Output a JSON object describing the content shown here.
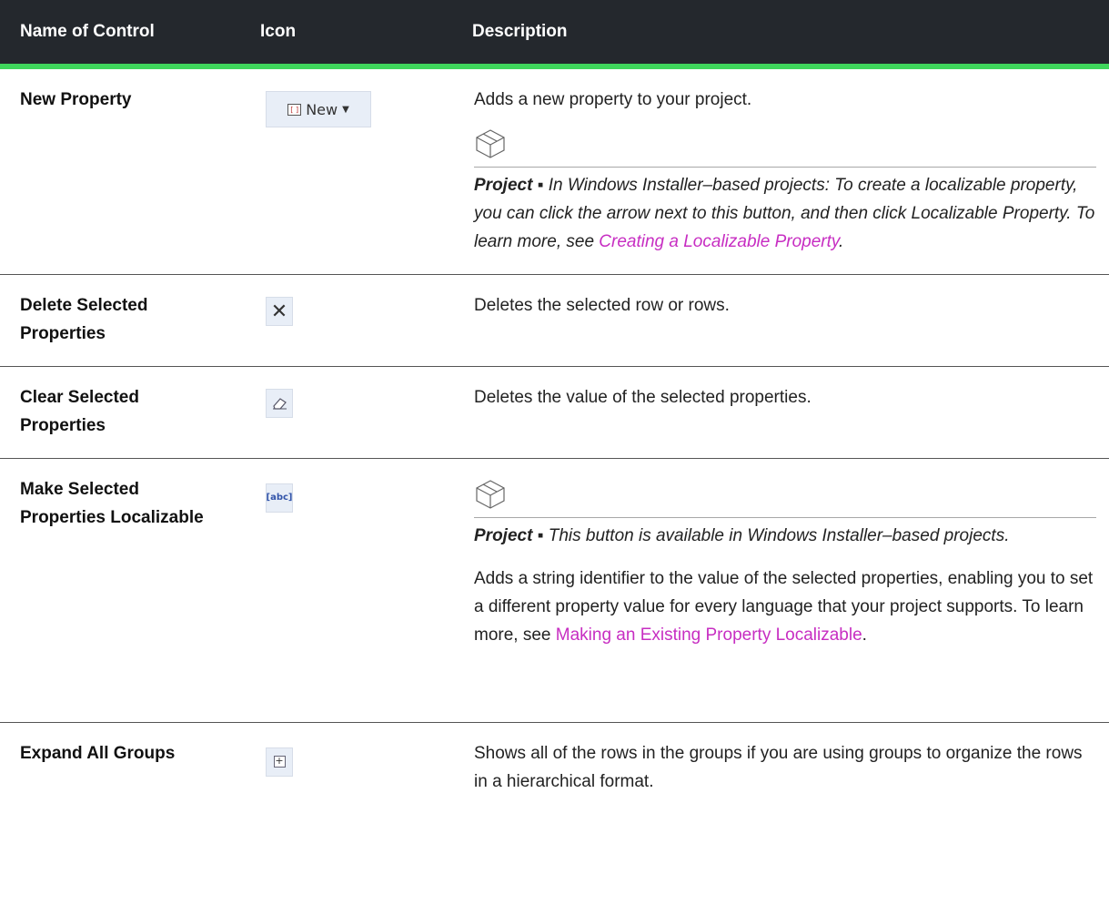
{
  "header": {
    "col_name": "Name of Control",
    "col_icon": "Icon",
    "col_desc": "Description"
  },
  "rows": [
    {
      "name": "New Property",
      "icon_name": "new-dropdown-icon",
      "icon_label": "New",
      "desc_text": "Adds a new property to your project.",
      "note_label": "Project ▪",
      "note_text": " In Windows Installer–based projects: To create a localizable property, you can click the arrow next to this button, and then click Localizable Property. To learn more, see ",
      "note_link": "Creating a Localizable Property",
      "note_end": "."
    },
    {
      "name": "Delete Selected Properties",
      "icon_name": "delete-x-icon",
      "desc_text": "Deletes the selected row or rows."
    },
    {
      "name": "Clear Selected Properties",
      "icon_name": "eraser-icon",
      "desc_text": "Deletes the value of the selected properties."
    },
    {
      "name": "Make Selected Properties Localizable",
      "icon_name": "abc-localize-icon",
      "note_label": "Project ▪",
      "note_text": " This button is available in Windows Installer–based projects.",
      "desc_text": "Adds a string identifier to the value of the selected properties, enabling you to set a different property value for every language that your project supports. To learn more, see ",
      "desc_link": "Making an Existing Property Localizable",
      "desc_end": "."
    },
    {
      "name": "Expand All Groups",
      "icon_name": "expand-plus-icon",
      "desc_text": "Shows all of the rows in the groups if you are using groups to organize the rows in a hierarchical format."
    }
  ],
  "colors": {
    "header_bg": "#24282d",
    "accent_bar": "#3fd65c",
    "link": "#c72ec2"
  }
}
